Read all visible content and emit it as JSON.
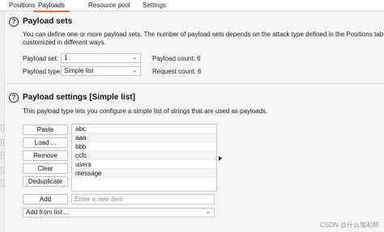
{
  "tabs": [
    {
      "label": "Positions"
    },
    {
      "label": "Payloads",
      "active": true
    },
    {
      "label": "Resource pool"
    },
    {
      "label": "Settings"
    }
  ],
  "payload_sets": {
    "title": "Payload sets",
    "description_line1": "You can define one or more payload sets. The number of payload sets depends on the attack type defined in the Positions tab. V",
    "description_line2": "customized in different ways.",
    "set_label": "Payload set:",
    "set_value": "1",
    "type_label": "Payload type:",
    "type_value": "Simple list",
    "payload_count": "Payload count: 6",
    "request_count": "Request count: 6"
  },
  "payload_settings": {
    "title": "Payload settings [Simple list]",
    "description": "This payload type lets you configure a simple list of strings that are used as payloads.",
    "buttons": {
      "paste": "Paste",
      "load": "Load ...",
      "remove": "Remove",
      "clear": "Clear",
      "deduplicate": "Deduplicate",
      "add": "Add"
    },
    "items": [
      "abc",
      "aaa",
      "bbb",
      "ccfc",
      "users",
      "message"
    ],
    "add_placeholder": "Enter a new item",
    "add_from_list": "Add from list ..."
  },
  "watermark": "CSDN @什么鬼昵称",
  "colors": {
    "active_tab_underline": "#e8743b"
  }
}
